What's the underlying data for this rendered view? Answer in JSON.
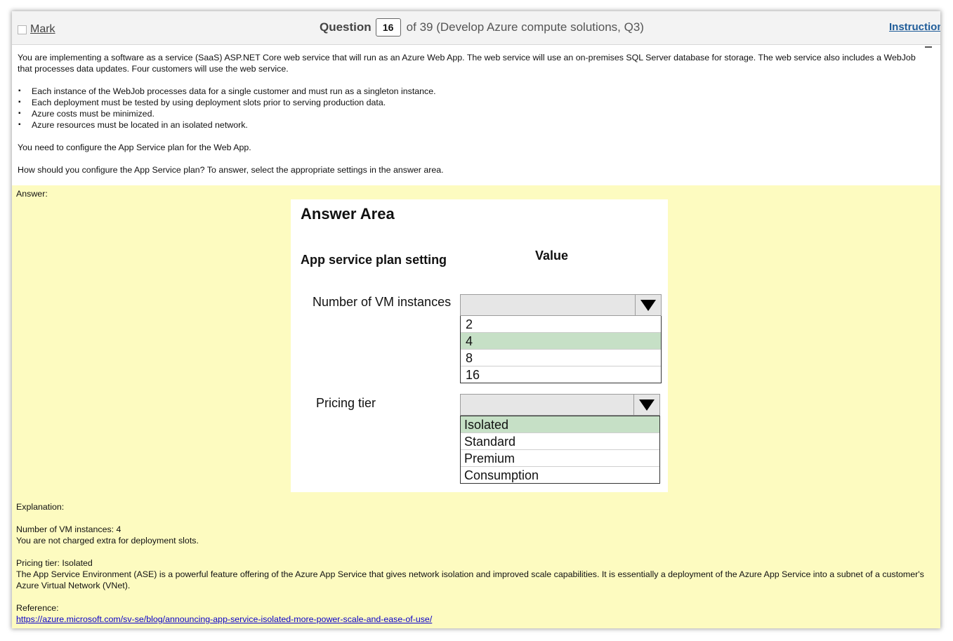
{
  "header": {
    "mark_label": "Mark",
    "question_word": "Question",
    "question_number": "16",
    "question_of": "of 39 (Develop Azure compute solutions, Q3)",
    "instructions_label": "Instructions"
  },
  "question": {
    "intro": "You are implementing a software as a service (SaaS) ASP.NET Core web service that will run as an Azure Web App. The web service will use an on-premises SQL Server database for storage. The web service also includes a WebJob that processes data updates. Four customers will use the web service.",
    "bullets": [
      "Each instance of the WebJob processes data for a single customer and must run as a singleton instance.",
      "Each deployment must be tested by using deployment slots prior to serving production data.",
      "Azure costs must be minimized.",
      "Azure resources must be located in an isolated network."
    ],
    "need": "You need to configure the App Service plan for the Web App.",
    "how": "How should you configure the App Service plan? To answer, select the appropriate settings in the answer area."
  },
  "answer": {
    "label": "Answer:",
    "area_title": "Answer Area",
    "setting_header": "App service plan setting",
    "value_header": "Value",
    "vm_label": "Number of VM instances",
    "vm_options": [
      "2",
      "4",
      "8",
      "16"
    ],
    "vm_selected": "4",
    "tier_label": "Pricing tier",
    "tier_options": [
      "Isolated",
      "Standard",
      "Premium",
      "Consumption"
    ],
    "tier_selected": "Isolated"
  },
  "explanation": {
    "label": "Explanation:",
    "vm_line": "Number of VM instances: 4",
    "vm_note": "You are not charged extra for deployment slots.",
    "tier_line": "Pricing tier: Isolated",
    "tier_note": "The App Service Environment (ASE) is a powerful feature offering of the Azure App Service that gives network isolation and improved scale capabilities. It is essentially a deployment of the Azure App Service into a subnet of a customer's Azure Virtual Network (VNet).",
    "reference_label": "Reference:",
    "reference_link": "https://azure.microsoft.com/sv-se/blog/announcing-app-service-isolated-more-power-scale-and-ease-of-use/"
  },
  "colors": {
    "answer_bg": "#fdfbc0",
    "selected_option": "#c6e0c6",
    "link": "#0b00c8",
    "instructions_link": "#1f5c99"
  }
}
